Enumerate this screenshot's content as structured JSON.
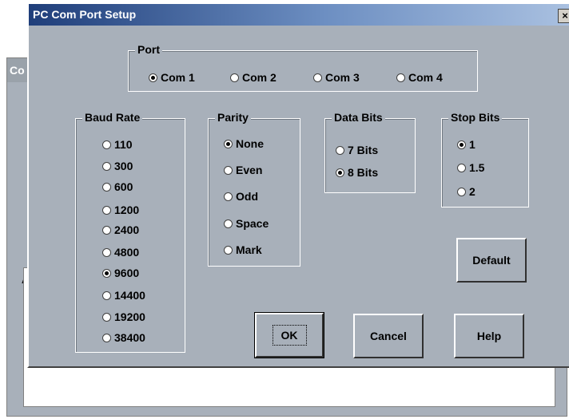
{
  "background_window": {
    "title_fragment": "Co",
    "label_fragment": "A"
  },
  "dialog": {
    "title": "PC Com Port Setup",
    "close_glyph": "×",
    "port": {
      "legend": "Port",
      "options": [
        "Com 1",
        "Com 2",
        "Com 3",
        "Com 4"
      ],
      "selected": "Com 1"
    },
    "baud_rate": {
      "legend": "Baud Rate",
      "options": [
        "110",
        "300",
        "600",
        "1200",
        "2400",
        "4800",
        "9600",
        "14400",
        "19200",
        "38400"
      ],
      "selected": "9600"
    },
    "parity": {
      "legend": "Parity",
      "options": [
        "None",
        "Even",
        "Odd",
        "Space",
        "Mark"
      ],
      "selected": "None"
    },
    "data_bits": {
      "legend": "Data Bits",
      "options": [
        "7 Bits",
        "8 Bits"
      ],
      "selected": "8 Bits"
    },
    "stop_bits": {
      "legend": "Stop Bits",
      "options": [
        "1",
        "1.5",
        "2"
      ],
      "selected": "1"
    },
    "buttons": {
      "default": "Default",
      "ok": "OK",
      "cancel": "Cancel",
      "help": "Help"
    }
  },
  "colors": {
    "dialog_bg": "#a8b0ba",
    "title_gradient_start": "#1f3e7a",
    "title_gradient_end": "#a9c0e0"
  }
}
